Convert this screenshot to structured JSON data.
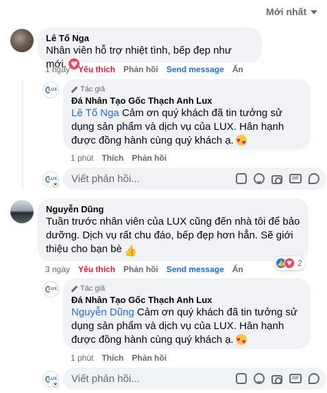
{
  "sort": {
    "label": "Mới nhất"
  },
  "comments": [
    {
      "author": "Lê Tố Nga",
      "text": "Nhân viên hỗ trợ nhiệt tình, bếp đẹp như mới.",
      "reaction_icon": "heart-icon",
      "actions": {
        "time": "1 ngày",
        "like": "Yêu thích",
        "reply": "Phản hồi",
        "send": "Send message",
        "hide": "Ẩn"
      },
      "reply": {
        "badge": "Tác giả",
        "author": "Đá Nhân Tạo Gốc Thạch Anh Lux",
        "mention": "Lê Tố Nga",
        "text": " Cảm ơn quý khách đã tin tưởng sử dụng sản phẩm và dịch vụ của LUX. Hân hạnh được đồng hành cùng quý khách ạ.",
        "actions": {
          "time": "1 phút",
          "like": "Thích",
          "reply": "Phản hồi"
        }
      },
      "reply_box": {
        "placeholder": "Viết phản hồi..."
      }
    },
    {
      "author": "Nguyễn Dũng",
      "text": "Tuần trước nhân viên của LUX cũng đến nhà tôi để bảo dưỡng. Dịch vụ rất chu đáo, bếp đẹp hơn hẳn. Sẽ giới thiệu cho bạn bè",
      "reaction_count": "2",
      "actions": {
        "time": "3 ngày",
        "like": "Yêu thích",
        "reply": "Phản hồi",
        "send": "Send message",
        "hide": "Ẩn"
      },
      "reply": {
        "badge": "Tác giả",
        "author": "Đá Nhân Tạo Gốc Thạch Anh Lux",
        "mention": "Nguyễn Dũng",
        "text": " Cảm ơn quý khách đã tin tưởng sử dụng sản phẩm và dịch vụ của LUX. Hân hạnh được đồng hành cùng quý khách ạ.",
        "actions": {
          "time": "1 phút",
          "like": "Thích",
          "reply": "Phản hồi"
        }
      },
      "reply_box": {
        "placeholder": "Viết phản hồi..."
      }
    }
  ],
  "avatar_logo_text": "LUX",
  "colors": {
    "link": "#216fdb",
    "liked": "#e41e3f",
    "send": "#1f6fd6",
    "bubble": "#f0f2f5",
    "muted": "#65676b"
  }
}
